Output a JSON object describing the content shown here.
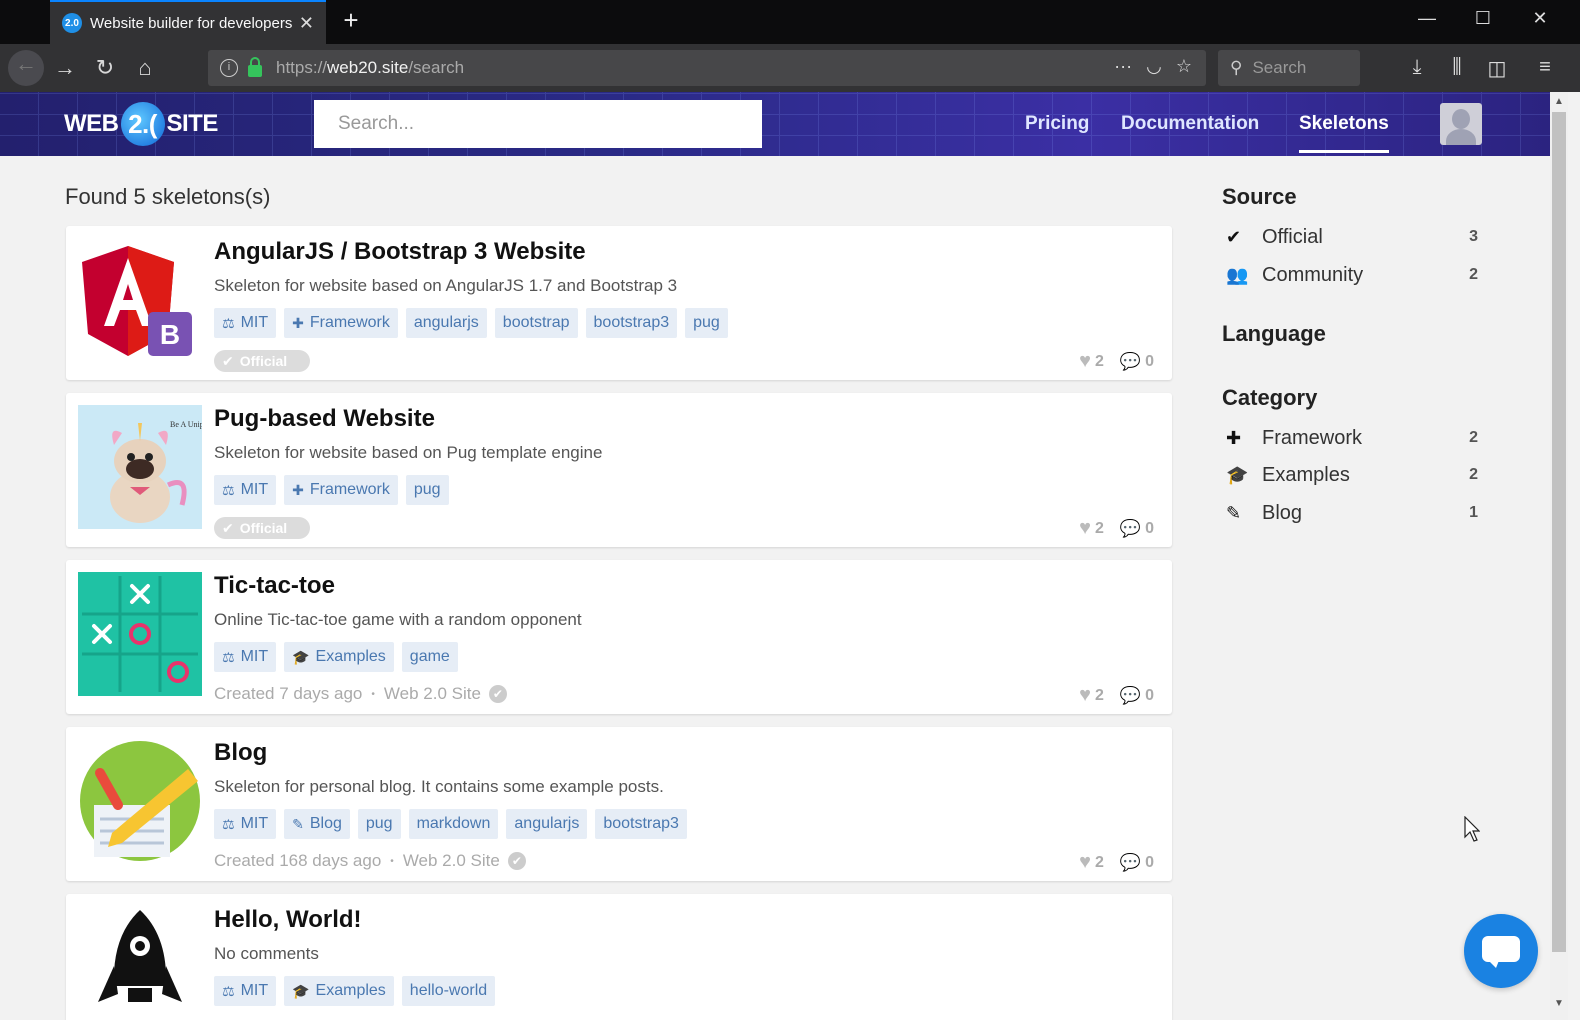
{
  "browser": {
    "tab_title": "Website builder for developers",
    "tab_favicon": "2.0",
    "url_scheme": "https://",
    "url_host": "web20.site",
    "url_path": "/search",
    "search_placeholder": "Search"
  },
  "site": {
    "logo_left": "WEB",
    "logo_mid": "2.(",
    "logo_right": "SITE",
    "search_placeholder": "Search...",
    "nav": [
      "Pricing",
      "Documentation",
      "Skeletons"
    ],
    "active_nav": "Skeletons"
  },
  "results": {
    "heading": "Found 5 skeletons(s)",
    "items": [
      {
        "title": "AngularJS / Bootstrap 3 Website",
        "description": "Skeleton for website based on AngularJS 1.7 and Bootstrap 3",
        "tags": [
          "MIT",
          "Framework",
          "angularjs",
          "bootstrap",
          "bootstrap3",
          "pug"
        ],
        "badge": "Official",
        "likes": "2",
        "comments": "0"
      },
      {
        "title": "Pug-based Website",
        "description": "Skeleton for website based on Pug template engine",
        "tags": [
          "MIT",
          "Framework",
          "pug"
        ],
        "badge": "Official",
        "likes": "2",
        "comments": "0"
      },
      {
        "title": "Tic-tac-toe",
        "description": "Online Tic-tac-toe game with a random opponent",
        "tags": [
          "MIT",
          "Examples",
          "game"
        ],
        "created": "Created 7 days ago",
        "author": "Web 2.0 Site",
        "likes": "2",
        "comments": "0"
      },
      {
        "title": "Blog",
        "description": "Skeleton for personal blog. It contains some example posts.",
        "tags": [
          "MIT",
          "Blog",
          "pug",
          "markdown",
          "angularjs",
          "bootstrap3"
        ],
        "created": "Created 168 days ago",
        "author": "Web 2.0 Site",
        "likes": "2",
        "comments": "0"
      },
      {
        "title": "Hello, World!",
        "description": "No comments",
        "tags": [
          "MIT",
          "Examples",
          "hello-world"
        ]
      }
    ]
  },
  "sidebar": {
    "source_heading": "Source",
    "source": [
      {
        "label": "Official",
        "count": "3",
        "icon": "check-icon"
      },
      {
        "label": "Community",
        "count": "2",
        "icon": "users-icon"
      }
    ],
    "language_heading": "Language",
    "category_heading": "Category",
    "category": [
      {
        "label": "Framework",
        "count": "2",
        "icon": "puzzle-icon"
      },
      {
        "label": "Examples",
        "count": "2",
        "icon": "graduation-cap-icon"
      },
      {
        "label": "Blog",
        "count": "1",
        "icon": "edit-icon"
      }
    ]
  },
  "colors": {
    "accent": "#1a82e2",
    "tag_bg": "#e6edf6",
    "tag_text": "#4a78b0",
    "header_bg": "#2a2a86"
  }
}
